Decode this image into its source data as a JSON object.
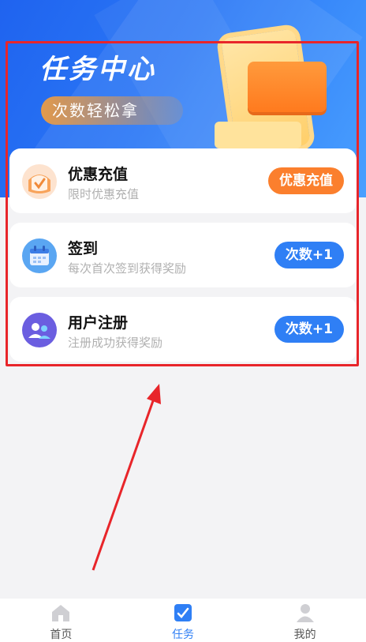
{
  "banner": {
    "title": "任务中心",
    "subtitle": "次数轻松拿"
  },
  "tasks": [
    {
      "title": "优惠充值",
      "desc": "限时优惠充值",
      "button": "优惠充值",
      "icon": "recharge-icon",
      "button_color": "#fb7f2d"
    },
    {
      "title": "签到",
      "desc": "每次首次签到获得奖励",
      "button": "次数+1",
      "icon": "calendar-icon",
      "button_color": "#2f7ff5"
    },
    {
      "title": "用户注册",
      "desc": "注册成功获得奖励",
      "button": "次数+1",
      "icon": "user-register-icon",
      "button_color": "#2f7ff5"
    }
  ],
  "tabbar": {
    "items": [
      {
        "label": "首页",
        "icon": "home-icon"
      },
      {
        "label": "任务",
        "icon": "task-icon",
        "active": true
      },
      {
        "label": "我的",
        "icon": "profile-icon"
      }
    ]
  },
  "colors": {
    "accent": "#2f7ff5",
    "orange": "#fb7f2d",
    "annotation": "#e8252a"
  }
}
